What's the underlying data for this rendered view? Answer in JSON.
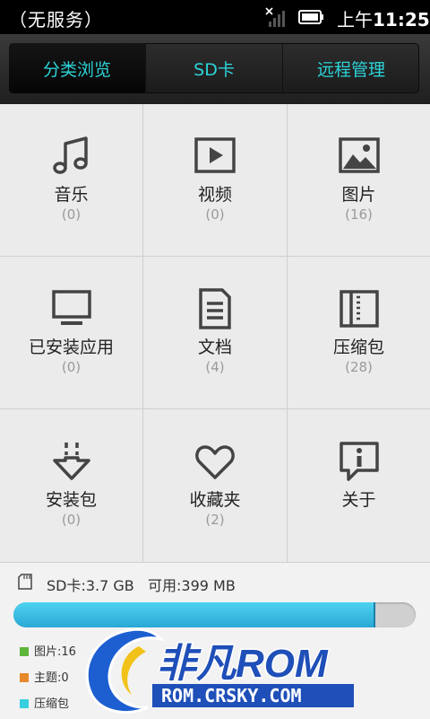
{
  "status_bar": {
    "carrier": "（无服务）",
    "time_prefix": "上午",
    "time": "11:25",
    "signal_icon": "no-signal-icon",
    "battery_icon": "battery-icon"
  },
  "tabs": [
    {
      "label": "分类浏览",
      "active": true
    },
    {
      "label": "SD卡",
      "active": false
    },
    {
      "label": "远程管理",
      "active": false
    }
  ],
  "categories": [
    {
      "label": "音乐",
      "count": "(0)",
      "icon": "music-note-icon"
    },
    {
      "label": "视频",
      "count": "(0)",
      "icon": "video-play-icon"
    },
    {
      "label": "图片",
      "count": "(16)",
      "icon": "picture-icon"
    },
    {
      "label": "已安装应用",
      "count": "(0)",
      "icon": "monitor-icon"
    },
    {
      "label": "文档",
      "count": "(4)",
      "icon": "document-icon"
    },
    {
      "label": "压缩包",
      "count": "(28)",
      "icon": "archive-icon"
    },
    {
      "label": "安装包",
      "count": "(0)",
      "icon": "install-download-icon"
    },
    {
      "label": "收藏夹",
      "count": "(2)",
      "icon": "heart-icon"
    },
    {
      "label": "关于",
      "count": "",
      "icon": "info-bubble-icon"
    }
  ],
  "storage": {
    "sd_label": "SD卡:3.7 GB",
    "available_label": "可用:399 MB",
    "used_fraction": 0.895,
    "legend": [
      {
        "label": "图片:16",
        "color": "#5cb63a"
      },
      {
        "label": "主题:0",
        "color": "#e6892a"
      },
      {
        "label": "压缩包",
        "color": "#38d0e0"
      }
    ]
  },
  "watermark": {
    "brand": "非凡ROM",
    "url": "ROM.CRSKY.COM"
  },
  "colors": {
    "accent_text": "#2cd3d8",
    "progress_fill": "#29a8d6"
  }
}
